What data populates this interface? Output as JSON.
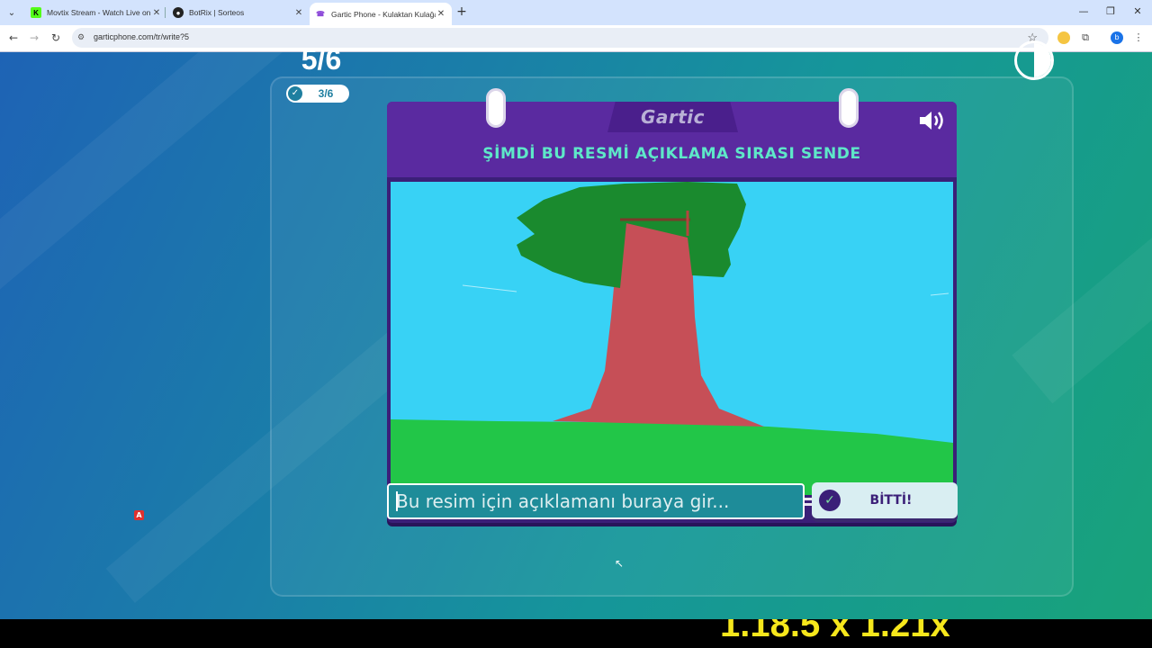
{
  "browser": {
    "tabs": [
      {
        "title": "Movtix Stream - Watch Live on",
        "favicon": "K",
        "favicon_color": "#53fc18"
      },
      {
        "title": "BotRix | Sorteos",
        "favicon": "●",
        "favicon_color": "#222222"
      },
      {
        "title": "Gartic Phone - Kulaktan Kulağa",
        "favicon": "☎",
        "favicon_color": "#8e4bd9"
      }
    ],
    "new_tab_symbol": "+",
    "url": "garticphone.com/tr/write?5",
    "profile_initial": "b"
  },
  "game": {
    "round": "5/6",
    "players_done": "3/6",
    "logo": "Gartic",
    "instruction": "ŞİMDİ BU RESMİ AÇIKLAMA SIRASI SENDE",
    "input_placeholder": "Bu resim için açıklamanı buraya gir...",
    "done_label": "BİTTİ!",
    "drawing_description_icons": [
      "tree-drawing"
    ]
  },
  "overlay": {
    "text": "1.18.5 x 1.21x"
  },
  "colors": {
    "card_purple": "#5a2aa0",
    "instruction_teal": "#5ee8c8",
    "sky": "#38d2f5",
    "grass": "#22c648",
    "trunk": "#c64f57",
    "leaves": "#1a8a2e"
  }
}
